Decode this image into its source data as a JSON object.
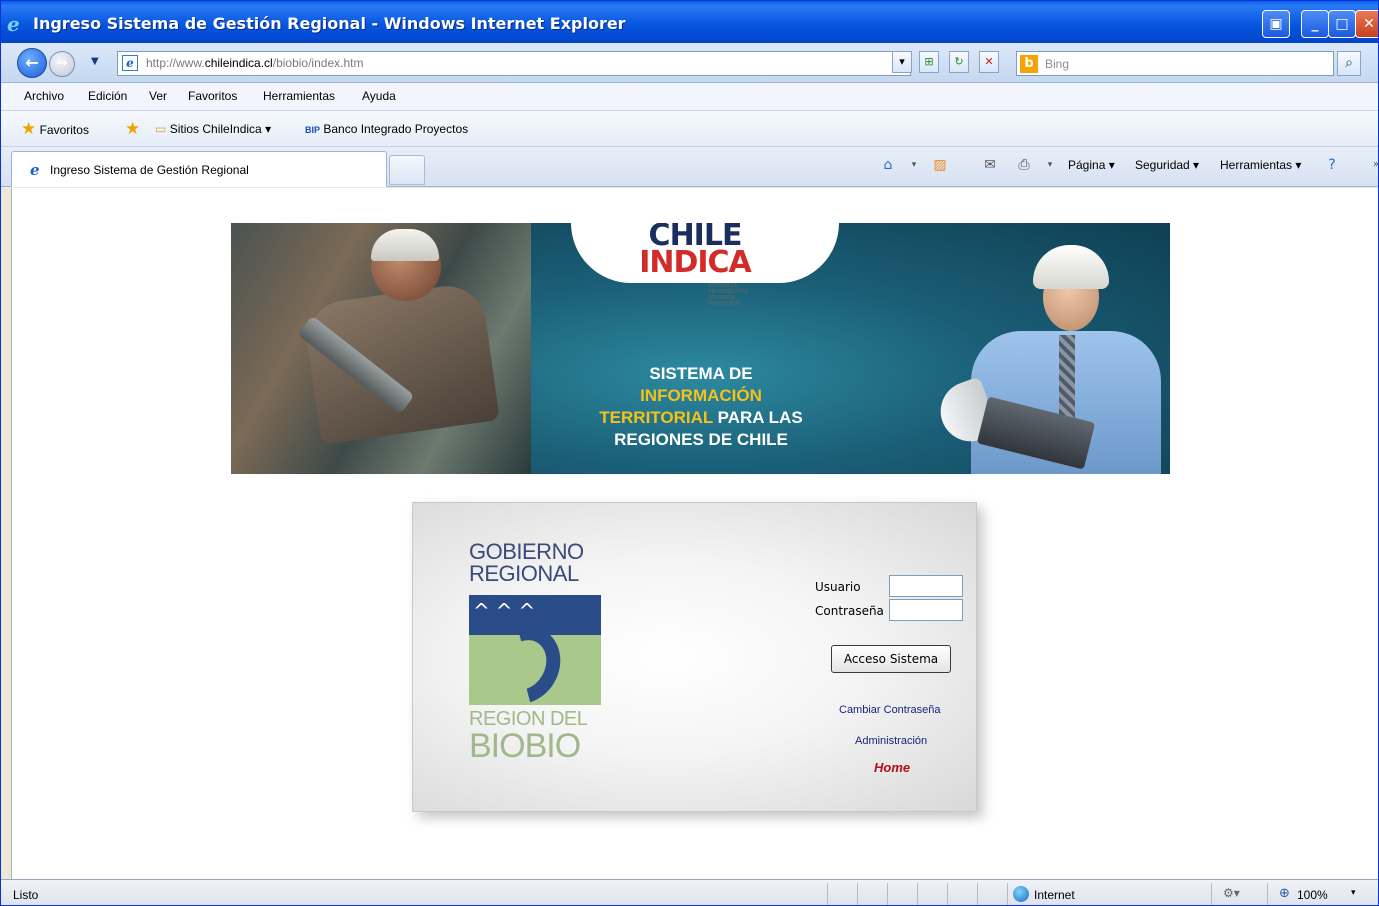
{
  "window": {
    "title": "Ingreso Sistema de Gestión Regional - Windows Internet Explorer"
  },
  "address": {
    "url_prefix": "http://www.",
    "url_domain": "chileindica.cl",
    "url_path": "/biobio/index.htm",
    "search_placeholder": "Bing"
  },
  "menu": {
    "items": [
      "Archivo",
      "Edición",
      "Ver",
      "Favoritos",
      "Herramientas",
      "Ayuda"
    ]
  },
  "favorites": {
    "label": "Favoritos",
    "items": [
      "Sitios ChileIndica ▾",
      "Banco Integrado Proyectos"
    ]
  },
  "tabs": {
    "active_label": "Ingreso Sistema de Gestión Regional"
  },
  "commands": {
    "pagina": "Página ▾",
    "seguridad": "Seguridad ▾",
    "herramientas": "Herramientas ▾"
  },
  "banner": {
    "logo_line1": "CHILE",
    "logo_line2": "INDICA",
    "logo_sub": "Sistema de información e inversión territorial",
    "tagline_1": "SISTEMA DE ",
    "tagline_hl1": "INFORMACIÓN",
    "tagline_hl2": "TERRITORIAL",
    "tagline_2": " PARA LAS",
    "tagline_3": "REGIONES DE CHILE"
  },
  "login": {
    "gob_line1": "GOBIERNO",
    "gob_line2": "REGIONAL",
    "gob_line3": "REGION  DEL",
    "gob_line4": "BIOBIO",
    "user_label": "Usuario",
    "pass_label": "Contraseña",
    "user_value": "",
    "pass_value": "",
    "submit_label": "Acceso Sistema",
    "change_pass_link": "Cambiar Contraseña",
    "admin_link": "Administración",
    "home_link": "Home"
  },
  "status": {
    "text": "Listo",
    "zone": "Internet",
    "zoom": "100%"
  }
}
